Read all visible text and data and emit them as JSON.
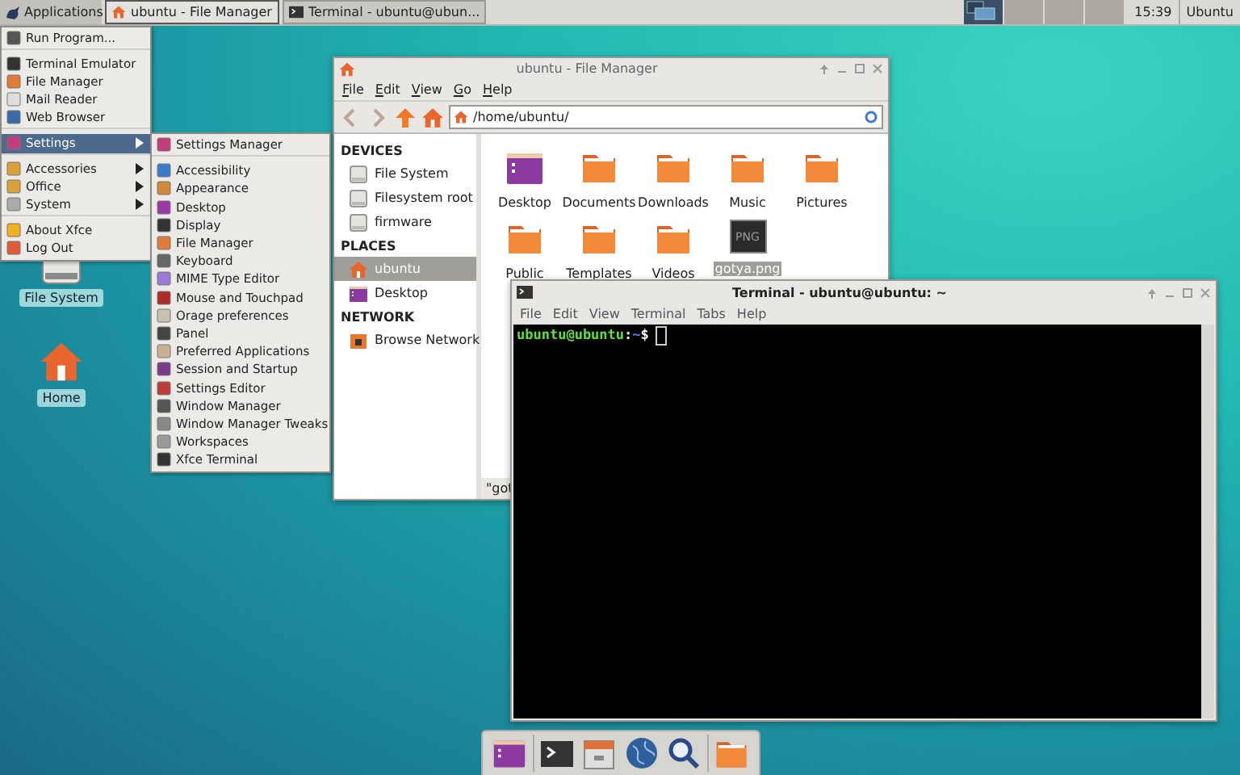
{
  "top_panel": {
    "applications_label": "Applications",
    "menu_open": true,
    "tasks": [
      {
        "label": "ubuntu - File Manager",
        "kind": "files",
        "selected": false
      },
      {
        "label": "Terminal - ubuntu@ubun...",
        "kind": "terminal",
        "selected": true
      }
    ],
    "workspaces": [
      {
        "selected": true
      },
      {
        "selected": false
      },
      {
        "selected": false
      },
      {
        "selected": false
      }
    ],
    "clock": "15:39",
    "user": "Ubuntu"
  },
  "applications_menu": {
    "items": [
      {
        "label": "Run Program...",
        "submenu": false,
        "selected": false,
        "separator_after": true
      },
      {
        "label": "Terminal Emulator",
        "submenu": false,
        "selected": false,
        "separator_after": false
      },
      {
        "label": "File Manager",
        "submenu": false,
        "selected": false,
        "separator_after": false
      },
      {
        "label": "Mail Reader",
        "submenu": false,
        "selected": false,
        "separator_after": false
      },
      {
        "label": "Web Browser",
        "submenu": false,
        "selected": false,
        "separator_after": true
      },
      {
        "label": "Settings",
        "submenu": true,
        "selected": true,
        "separator_after": true
      },
      {
        "label": "Accessories",
        "submenu": true,
        "selected": false,
        "separator_after": false
      },
      {
        "label": "Office",
        "submenu": true,
        "selected": false,
        "separator_after": false
      },
      {
        "label": "System",
        "submenu": true,
        "selected": false,
        "separator_after": true
      },
      {
        "label": "About Xfce",
        "submenu": false,
        "selected": false,
        "separator_after": false
      },
      {
        "label": "Log Out",
        "submenu": false,
        "selected": false,
        "separator_after": false
      }
    ]
  },
  "settings_menu": {
    "items": [
      {
        "label": "Settings Manager",
        "separator_after": true
      },
      {
        "label": "Accessibility",
        "separator_after": false
      },
      {
        "label": "Appearance",
        "separator_after": false
      },
      {
        "label": "Desktop",
        "separator_after": false
      },
      {
        "label": "Display",
        "separator_after": false
      },
      {
        "label": "File Manager",
        "separator_after": false
      },
      {
        "label": "Keyboard",
        "separator_after": false
      },
      {
        "label": "MIME Type Editor",
        "separator_after": false
      },
      {
        "label": "Mouse and Touchpad",
        "separator_after": false
      },
      {
        "label": "Orage preferences",
        "separator_after": false
      },
      {
        "label": "Panel",
        "separator_after": false
      },
      {
        "label": "Preferred Applications",
        "separator_after": false
      },
      {
        "label": "Session and Startup",
        "separator_after": false
      },
      {
        "label": "Settings Editor",
        "separator_after": false
      },
      {
        "label": "Window Manager",
        "separator_after": false
      },
      {
        "label": "Window Manager Tweaks",
        "separator_after": false
      },
      {
        "label": "Workspaces",
        "separator_after": false
      },
      {
        "label": "Xfce Terminal",
        "separator_after": false
      }
    ]
  },
  "desktop_icons": [
    {
      "label": "File System",
      "kind": "drive"
    },
    {
      "label": "Home",
      "kind": "home"
    }
  ],
  "file_manager": {
    "title": "ubuntu - File Manager",
    "menu": [
      "File",
      "Edit",
      "View",
      "Go",
      "Help"
    ],
    "location": "/home/ubuntu/",
    "sidebar": [
      {
        "heading": "DEVICES",
        "items": [
          {
            "label": "File System",
            "kind": "drive",
            "selected": false
          },
          {
            "label": "Filesystem root",
            "kind": "drive",
            "selected": false
          },
          {
            "label": "firmware",
            "kind": "drive",
            "selected": false
          }
        ]
      },
      {
        "heading": "PLACES",
        "items": [
          {
            "label": "ubuntu",
            "kind": "home",
            "selected": true
          },
          {
            "label": "Desktop",
            "kind": "desktop",
            "selected": false
          }
        ]
      },
      {
        "heading": "NETWORK",
        "items": [
          {
            "label": "Browse Network",
            "kind": "network",
            "selected": false
          }
        ]
      }
    ],
    "files": [
      {
        "label": "Desktop",
        "kind": "desktop",
        "selected": false
      },
      {
        "label": "Documents",
        "kind": "folder",
        "selected": false
      },
      {
        "label": "Downloads",
        "kind": "folder",
        "selected": false
      },
      {
        "label": "Music",
        "kind": "folder",
        "selected": false
      },
      {
        "label": "Pictures",
        "kind": "folder",
        "selected": false
      },
      {
        "label": "Public",
        "kind": "folder",
        "selected": false
      },
      {
        "label": "Templates",
        "kind": "folder",
        "selected": false
      },
      {
        "label": "Videos",
        "kind": "folder",
        "selected": false
      },
      {
        "label": "gotya.png",
        "kind": "image",
        "thumbnail_text": "PNG",
        "selected": true
      }
    ],
    "status": "\"got"
  },
  "terminal": {
    "title": "Terminal - ubuntu@ubuntu: ~",
    "menu": [
      "File",
      "Edit",
      "View",
      "Terminal",
      "Tabs",
      "Help"
    ],
    "prompt": {
      "user_host": "ubuntu@ubuntu",
      "separator": ":",
      "path": "~",
      "symbol": "$"
    }
  },
  "dock": [
    {
      "kind": "desktop",
      "separator_after": true
    },
    {
      "kind": "terminal",
      "separator_after": false
    },
    {
      "kind": "cabinet",
      "separator_after": false
    },
    {
      "kind": "globe",
      "separator_after": false
    },
    {
      "kind": "search",
      "separator_after": true
    },
    {
      "kind": "folder",
      "separator_after": false
    }
  ]
}
